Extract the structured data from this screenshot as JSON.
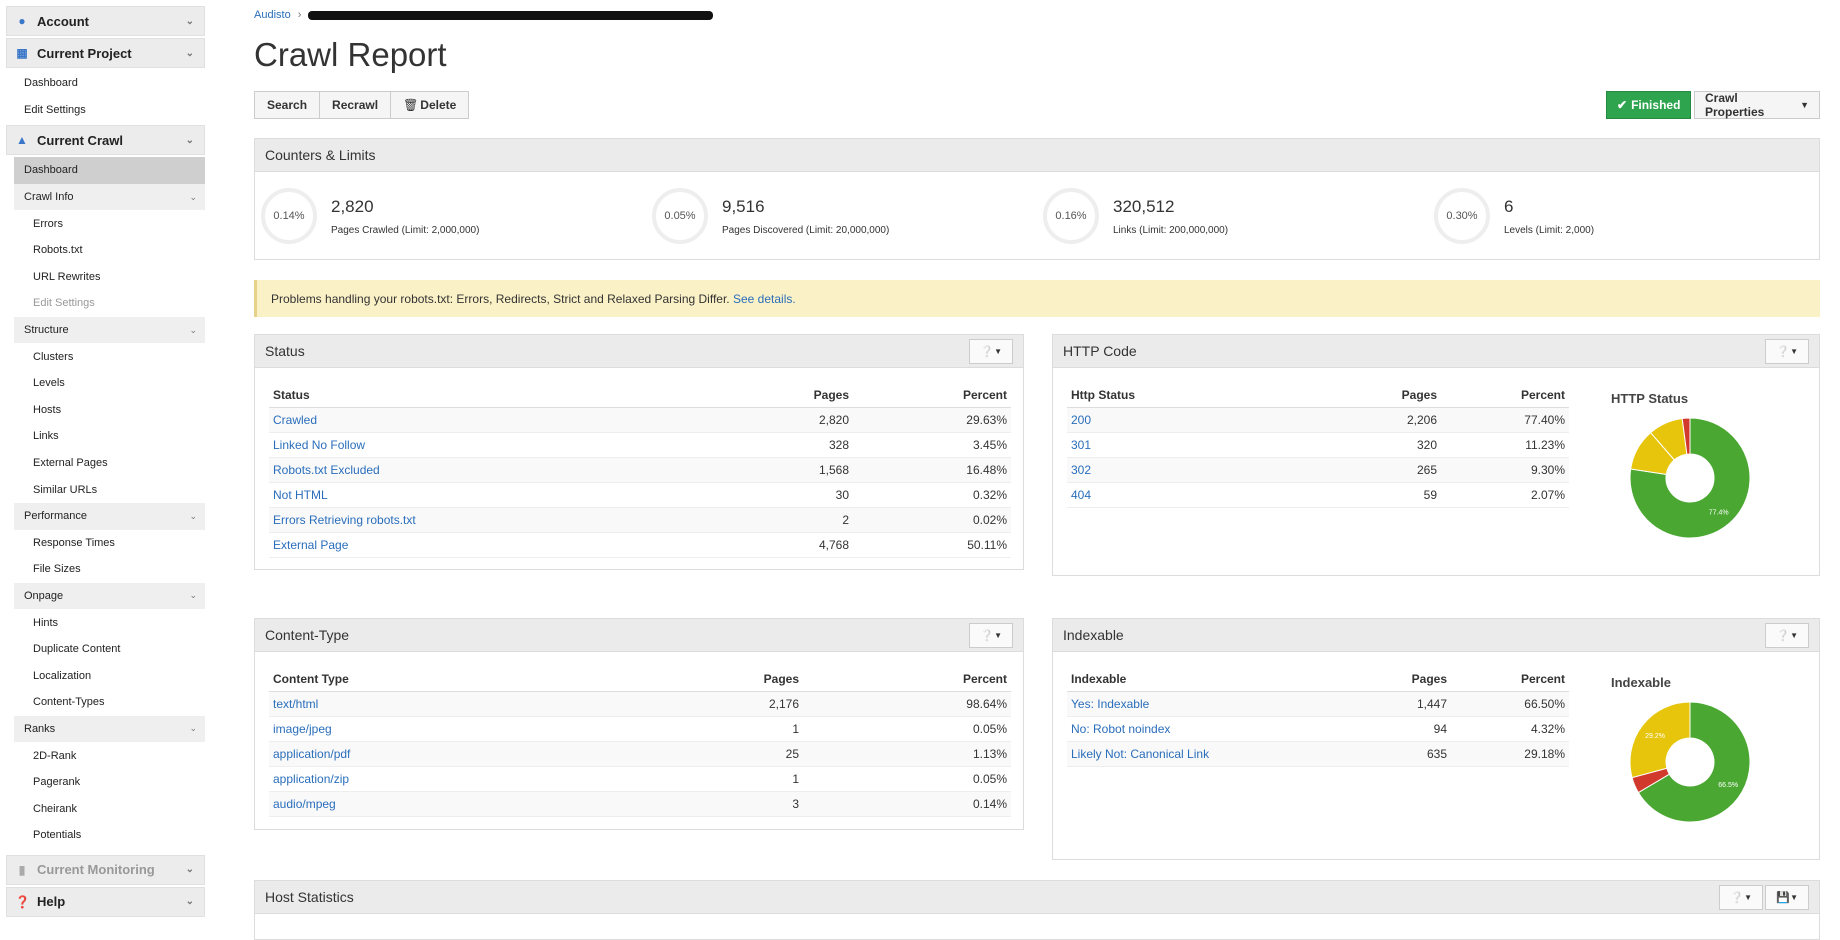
{
  "sidebar": {
    "account": "Account",
    "current_project": "Current Project",
    "project_items": [
      "Dashboard",
      "Edit Settings"
    ],
    "current_crawl": "Current Crawl",
    "crawl_dashboard": "Dashboard",
    "crawl_info": "Crawl Info",
    "crawl_info_items": [
      "Errors",
      "Robots.txt",
      "URL Rewrites",
      "Edit Settings"
    ],
    "structure": "Structure",
    "structure_items": [
      "Clusters",
      "Levels",
      "Hosts",
      "Links",
      "External Pages",
      "Similar URLs"
    ],
    "performance": "Performance",
    "performance_items": [
      "Response Times",
      "File Sizes"
    ],
    "onpage": "Onpage",
    "onpage_items": [
      "Hints",
      "Duplicate Content",
      "Localization",
      "Content-Types"
    ],
    "ranks": "Ranks",
    "ranks_items": [
      "2D-Rank",
      "Pagerank",
      "Cheirank",
      "Potentials"
    ],
    "current_monitoring": "Current Monitoring",
    "help": "Help"
  },
  "breadcrumb": {
    "root": "Audisto"
  },
  "page_title": "Crawl Report",
  "toolbar": {
    "search": "Search",
    "recrawl": "Recrawl",
    "delete": "Delete",
    "finished": "Finished",
    "crawl_properties": "Crawl Properties"
  },
  "counters": {
    "title": "Counters & Limits",
    "items": [
      {
        "pct": "0.14%",
        "value": "2,820",
        "label": "Pages Crawled (Limit: 2,000,000)"
      },
      {
        "pct": "0.05%",
        "value": "9,516",
        "label": "Pages Discovered (Limit: 20,000,000)"
      },
      {
        "pct": "0.16%",
        "value": "320,512",
        "label": "Links (Limit: 200,000,000)"
      },
      {
        "pct": "0.30%",
        "value": "6",
        "label": "Levels (Limit: 2,000)"
      }
    ]
  },
  "alert": {
    "text": "Problems handling your robots.txt: Errors, Redirects, Strict and Relaxed Parsing Differ.",
    "link": "See details."
  },
  "status_panel": {
    "title": "Status",
    "headers": [
      "Status",
      "Pages",
      "Percent"
    ],
    "rows": [
      [
        "Crawled",
        "2,820",
        "29.63%"
      ],
      [
        "Linked No Follow",
        "328",
        "3.45%"
      ],
      [
        "Robots.txt Excluded",
        "1,568",
        "16.48%"
      ],
      [
        "Not HTML",
        "30",
        "0.32%"
      ],
      [
        "Errors Retrieving robots.txt",
        "2",
        "0.02%"
      ],
      [
        "External Page",
        "4,768",
        "50.11%"
      ]
    ]
  },
  "http_panel": {
    "title": "HTTP Code",
    "headers": [
      "Http Status",
      "Pages",
      "Percent"
    ],
    "rows": [
      [
        "200",
        "2,206",
        "77.40%"
      ],
      [
        "301",
        "320",
        "11.23%"
      ],
      [
        "302",
        "265",
        "9.30%"
      ],
      [
        "404",
        "59",
        "2.07%"
      ]
    ],
    "chart_title": "HTTP Status",
    "slices": [
      {
        "value": 77.4,
        "color": "#4aa832"
      },
      {
        "value": 11.23,
        "color": "#e6c50c"
      },
      {
        "value": 9.3,
        "color": "#e6c50c"
      },
      {
        "value": 2.07,
        "color": "#d0392b"
      }
    ],
    "slice_label": "77.4%"
  },
  "content_panel": {
    "title": "Content-Type",
    "headers": [
      "Content Type",
      "Pages",
      "Percent"
    ],
    "rows": [
      [
        "text/html",
        "2,176",
        "98.64%"
      ],
      [
        "image/jpeg",
        "1",
        "0.05%"
      ],
      [
        "application/pdf",
        "25",
        "1.13%"
      ],
      [
        "application/zip",
        "1",
        "0.05%"
      ],
      [
        "audio/mpeg",
        "3",
        "0.14%"
      ]
    ]
  },
  "indexable_panel": {
    "title": "Indexable",
    "headers": [
      "Indexable",
      "Pages",
      "Percent"
    ],
    "rows": [
      [
        "Yes: Indexable",
        "1,447",
        "66.50%"
      ],
      [
        "No: Robot noindex",
        "94",
        "4.32%"
      ],
      [
        "Likely Not: Canonical Link",
        "635",
        "29.18%"
      ]
    ],
    "chart_title": "Indexable",
    "slices": [
      {
        "value": 66.5,
        "color": "#4aa832"
      },
      {
        "value": 4.32,
        "color": "#d0392b"
      },
      {
        "value": 29.18,
        "color": "#e6c50c"
      }
    ],
    "slice_labels": [
      "66.5%",
      "29.2%"
    ]
  },
  "host_panel": {
    "title": "Host Statistics"
  }
}
